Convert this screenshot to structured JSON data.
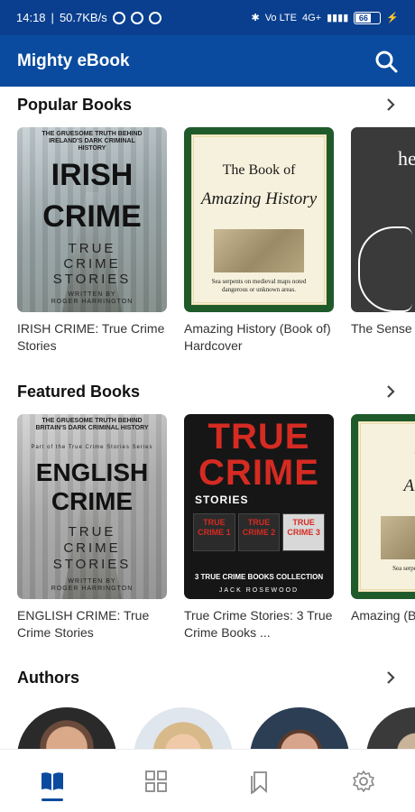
{
  "status_bar": {
    "time": "14:18",
    "speed": "50.7KB/s",
    "battery": "66",
    "network": "4G+",
    "volte": "Vo LTE"
  },
  "app_bar": {
    "title": "Mighty eBook",
    "search_icon": "search-icon"
  },
  "sections": {
    "popular": {
      "title": "Popular Books",
      "books": [
        {
          "title": "IRISH CRIME: True Crime Stories",
          "cover_tag": "THE GRUESOME TRUTH BEHIND IRELAND'S DARK CRIMINAL HISTORY",
          "cover_big1": "IRISH",
          "cover_big2": "CRIME",
          "cover_sub1": "TRUE",
          "cover_sub2": "CRIME",
          "cover_sub3": "STORIES",
          "cover_author": "ROGER HARRINGTON",
          "cover_written": "WRITTEN BY"
        },
        {
          "title": "Amazing History (Book of) Hardcover",
          "cover_line1": "The Book of",
          "cover_line2": "Amazing History",
          "cover_caption": "Sea serpents on medieval maps noted dangerous or unknown areas."
        },
        {
          "title": "The Sense of an Ann Ki",
          "cover_word": "he"
        }
      ]
    },
    "featured": {
      "title": "Featured Books",
      "books": [
        {
          "title": "ENGLISH CRIME: True Crime Stories",
          "cover_tag": "THE GRUESOME TRUTH BEHIND BRITAIN'S DARK CRIMINAL HISTORY",
          "cover_series": "Part of the True Crime Stories Series",
          "cover_big1": "ENGLISH",
          "cover_big2": "CRIME",
          "cover_sub1": "TRUE",
          "cover_sub2": "CRIME",
          "cover_sub3": "STORIES",
          "cover_author": "ROGER HARRINGTON",
          "cover_written": "WRITTEN BY"
        },
        {
          "title": "True Crime Stories: 3 True Crime Books ...",
          "cover_big1": "TRUE",
          "cover_big2": "CRIME",
          "cover_stories": "STORIES",
          "mini1": "TRUE CRIME 1",
          "mini2": "TRUE CRIME 2",
          "mini3": "TRUE CRIME 3",
          "cover_collect": "3 TRUE CRIME BOOKS COLLECTION",
          "cover_author": "JACK ROSEWOOD"
        },
        {
          "title": "Amazing (Book of)",
          "cover_line1": "The",
          "cover_line2": "Am Hi",
          "cover_caption": "Sea serpent noted dangero"
        }
      ]
    },
    "authors": {
      "title": "Authors"
    }
  },
  "bottom_nav": {
    "items": [
      "book-open-icon",
      "grid-icon",
      "bookmark-icon",
      "settings-icon"
    ],
    "active_color": "#0a4b9f"
  },
  "colors": {
    "primary": "#0a4b9f",
    "status_bar": "#0a3f8f"
  }
}
